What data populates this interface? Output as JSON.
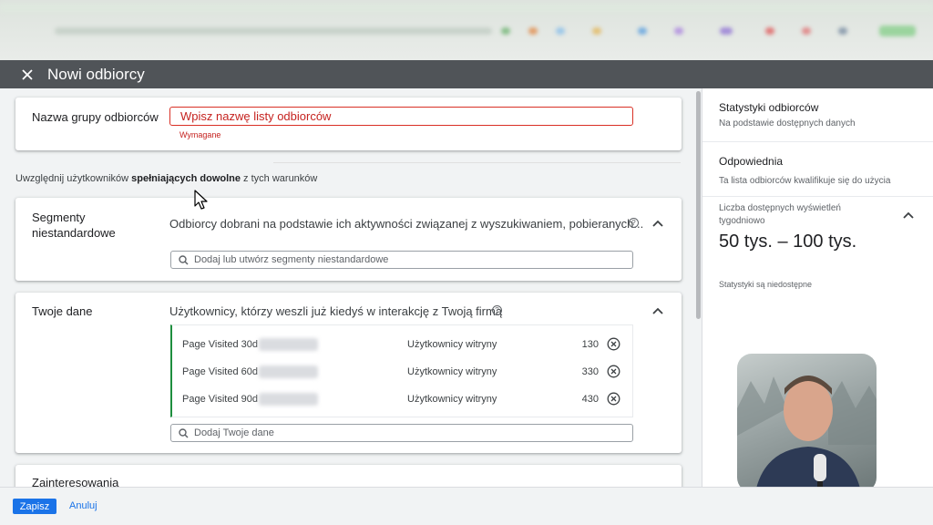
{
  "header": {
    "title": "Nowi odbiorcy"
  },
  "name_section": {
    "label": "Nazwa grupy odbiorców",
    "placeholder": "Wpisz nazwę listy odbiorców",
    "required_text": "Wymagane"
  },
  "hint": {
    "prefix": "Uwzględnij użytkowników ",
    "bold": "spełniających dowolne",
    "suffix": " z tych warunków"
  },
  "custom_segments": {
    "title_line1": "Segmenty",
    "title_line2": "niestandardowe",
    "description": "Odbiorcy dobrani na podstawie ich aktywności związanej z wyszukiwaniem, pobieranych...",
    "search_placeholder": "Dodaj lub utwórz segmenty niestandardowe"
  },
  "your_data": {
    "title": "Twoje dane",
    "description": "Użytkownicy, którzy weszli już kiedyś w interakcję z Twoją firmą",
    "items": [
      {
        "name": "Page Visited 30d",
        "type": "Użytkownicy witryny",
        "count": "130"
      },
      {
        "name": "Page Visited 60d",
        "type": "Użytkownicy witryny",
        "count": "330"
      },
      {
        "name": "Page Visited 90d",
        "type": "Użytkownicy witryny",
        "count": "430"
      }
    ],
    "search_placeholder": "Dodaj Twoje dane"
  },
  "interests": {
    "title": "Zainteresowania"
  },
  "side_panel": {
    "title": "Statystyki odbiorców",
    "subtitle": "Na podstawie dostępnych danych",
    "status_title": "Odpowiednia",
    "status_desc": "Ta lista odbiorców kwalifikuje się do użycia",
    "impressions_label": "Liczba dostępnych wyświetleń tygodniowo",
    "impressions_value": "50 tys. – 100 tys.",
    "stats_unavailable": "Statystyki są niedostępne"
  },
  "footer": {
    "save_label": "Zapisz",
    "cancel_label": "Anuluj"
  },
  "colors": {
    "accent": "#1a73e8",
    "error": "#c5221f",
    "header_bg": "#505458",
    "list_marker": "#1e8e3e"
  },
  "icons": {
    "close": "close-icon",
    "search": "search-icon",
    "help": "help-circle-icon",
    "chevron": "chevron-up-icon",
    "remove": "remove-circle-icon"
  }
}
